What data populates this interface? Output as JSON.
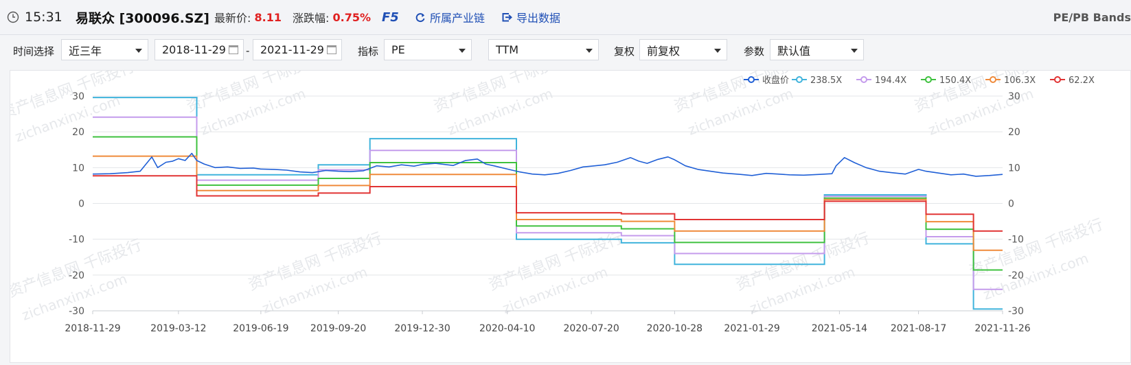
{
  "header": {
    "time": "15:31",
    "stock": "易联众 [300096.SZ]",
    "latest_label": "最新价:",
    "latest_value": "8.11",
    "change_label": "涨跌幅:",
    "change_value": "0.75%",
    "f5": "F5",
    "industry_link": "所属产业链",
    "export_link": "导出数据",
    "page_title": "PE/PB Bands",
    "accent": "#1f4fb5",
    "up_color": "#e02020"
  },
  "filters": {
    "time_label": "时间选择",
    "time_value": "近三年",
    "start_date": "2018-11-29",
    "date_sep": "-",
    "end_date": "2021-11-29",
    "indicator_label": "指标",
    "indicator_value": "PE",
    "ttm_value": "TTM",
    "adjust_label": "复权",
    "adjust_value": "前复权",
    "param_label": "参数",
    "param_value": "默认值"
  },
  "watermark": {
    "cn": "资产信息网 千际投行",
    "en": "zichanxinxi.com"
  },
  "chart_data": {
    "type": "line",
    "title": "",
    "xlabel": "",
    "ylabel": "",
    "ylim": [
      -30,
      30
    ],
    "yticks": [
      30,
      20,
      10,
      0,
      -10,
      -20,
      -30
    ],
    "xticks": [
      "2018-11-29",
      "2019-03-12",
      "2019-06-19",
      "2019-09-20",
      "2019-12-30",
      "2020-04-10",
      "2020-07-20",
      "2020-10-28",
      "2021-01-29",
      "2021-05-14",
      "2021-08-17",
      "2021-11-26"
    ],
    "xrange": [
      "2018-11-29",
      "2021-11-26"
    ],
    "grid": true,
    "legend_position": "top-right",
    "band_periods": [
      {
        "start": "2018-11-29",
        "end": "2019-04-03"
      },
      {
        "start": "2019-04-03",
        "end": "2019-08-27"
      },
      {
        "start": "2019-08-27",
        "end": "2019-10-28"
      },
      {
        "start": "2019-10-28",
        "end": "2020-04-21"
      },
      {
        "start": "2020-04-21",
        "end": "2020-08-25"
      },
      {
        "start": "2020-08-25",
        "end": "2020-10-28"
      },
      {
        "start": "2020-10-28",
        "end": "2021-04-26"
      },
      {
        "start": "2021-04-26",
        "end": "2021-08-26"
      },
      {
        "start": "2021-08-26",
        "end": "2021-10-22"
      },
      {
        "start": "2021-10-22",
        "end": "2021-11-26"
      }
    ],
    "series": [
      {
        "name": "收盘价",
        "color": "#1f5fd6",
        "type": "price",
        "points": [
          [
            "2018-11-29",
            8.2
          ],
          [
            "2018-12-20",
            8.3
          ],
          [
            "2019-01-10",
            8.6
          ],
          [
            "2019-01-25",
            9.0
          ],
          [
            "2019-02-08",
            13.0
          ],
          [
            "2019-02-15",
            10.0
          ],
          [
            "2019-02-25",
            11.5
          ],
          [
            "2019-03-05",
            11.8
          ],
          [
            "2019-03-12",
            12.5
          ],
          [
            "2019-03-20",
            12.0
          ],
          [
            "2019-03-28",
            14.0
          ],
          [
            "2019-04-03",
            12.0
          ],
          [
            "2019-04-12",
            11.0
          ],
          [
            "2019-04-25",
            10.0
          ],
          [
            "2019-05-10",
            10.2
          ],
          [
            "2019-05-25",
            9.8
          ],
          [
            "2019-06-10",
            9.9
          ],
          [
            "2019-06-19",
            9.6
          ],
          [
            "2019-07-05",
            9.5
          ],
          [
            "2019-07-20",
            9.3
          ],
          [
            "2019-08-05",
            8.8
          ],
          [
            "2019-08-20",
            8.6
          ],
          [
            "2019-09-05",
            9.2
          ],
          [
            "2019-09-20",
            9.0
          ],
          [
            "2019-10-05",
            8.9
          ],
          [
            "2019-10-20",
            9.1
          ],
          [
            "2019-11-05",
            10.5
          ],
          [
            "2019-11-20",
            10.2
          ],
          [
            "2019-12-05",
            10.8
          ],
          [
            "2019-12-20",
            10.4
          ],
          [
            "2019-12-30",
            10.9
          ],
          [
            "2020-01-15",
            11.2
          ],
          [
            "2020-02-05",
            10.6
          ],
          [
            "2020-02-20",
            12.0
          ],
          [
            "2020-03-05",
            12.4
          ],
          [
            "2020-03-15",
            11.0
          ],
          [
            "2020-03-25",
            10.5
          ],
          [
            "2020-04-10",
            9.6
          ],
          [
            "2020-04-25",
            8.8
          ],
          [
            "2020-05-10",
            8.2
          ],
          [
            "2020-05-25",
            8.0
          ],
          [
            "2020-06-10",
            8.4
          ],
          [
            "2020-06-25",
            9.2
          ],
          [
            "2020-07-10",
            10.2
          ],
          [
            "2020-07-20",
            10.4
          ],
          [
            "2020-08-05",
            10.8
          ],
          [
            "2020-08-20",
            11.5
          ],
          [
            "2020-09-05",
            12.8
          ],
          [
            "2020-09-15",
            11.8
          ],
          [
            "2020-09-25",
            11.2
          ],
          [
            "2020-10-08",
            12.3
          ],
          [
            "2020-10-20",
            13.0
          ],
          [
            "2020-10-28",
            12.2
          ],
          [
            "2020-11-10",
            10.5
          ],
          [
            "2020-11-25",
            9.5
          ],
          [
            "2020-12-10",
            9.0
          ],
          [
            "2020-12-25",
            8.5
          ],
          [
            "2021-01-15",
            8.1
          ],
          [
            "2021-01-29",
            7.8
          ],
          [
            "2021-02-15",
            8.4
          ],
          [
            "2021-03-01",
            8.2
          ],
          [
            "2021-03-15",
            8.0
          ],
          [
            "2021-04-01",
            7.9
          ],
          [
            "2021-04-20",
            8.1
          ],
          [
            "2021-05-05",
            8.3
          ],
          [
            "2021-05-10",
            10.5
          ],
          [
            "2021-05-20",
            12.8
          ],
          [
            "2021-06-01",
            11.4
          ],
          [
            "2021-06-15",
            10.0
          ],
          [
            "2021-07-01",
            9.0
          ],
          [
            "2021-07-15",
            8.6
          ],
          [
            "2021-08-01",
            8.2
          ],
          [
            "2021-08-17",
            9.5
          ],
          [
            "2021-08-26",
            9.0
          ],
          [
            "2021-09-10",
            8.5
          ],
          [
            "2021-09-25",
            8.0
          ],
          [
            "2021-10-10",
            8.2
          ],
          [
            "2021-10-25",
            7.6
          ],
          [
            "2021-11-10",
            7.8
          ],
          [
            "2021-11-26",
            8.1
          ]
        ]
      },
      {
        "name": "238.5X",
        "color": "#3fb3dc",
        "values": [
          29.6,
          8.0,
          10.8,
          18.1,
          -10.0,
          -11.0,
          -17.0,
          2.4,
          -11.3,
          -29.5
        ]
      },
      {
        "name": "194.4X",
        "color": "#c49bec",
        "values": [
          24.1,
          6.5,
          9.4,
          14.8,
          -8.2,
          -9.0,
          -14.0,
          2.0,
          -9.3,
          -24.0
        ]
      },
      {
        "name": "150.4X",
        "color": "#3ec13e",
        "values": [
          18.6,
          5.1,
          7.0,
          11.4,
          -6.3,
          -7.1,
          -10.9,
          1.5,
          -7.2,
          -18.6
        ]
      },
      {
        "name": "106.3X",
        "color": "#ef8a3a",
        "values": [
          13.2,
          3.6,
          5.0,
          8.1,
          -4.5,
          -5.0,
          -7.7,
          1.1,
          -5.1,
          -13.1
        ]
      },
      {
        "name": "62.2X",
        "color": "#e13333",
        "values": [
          7.7,
          2.1,
          2.9,
          4.7,
          -2.6,
          -2.9,
          -4.5,
          0.6,
          -3.0,
          -7.7
        ]
      }
    ]
  }
}
